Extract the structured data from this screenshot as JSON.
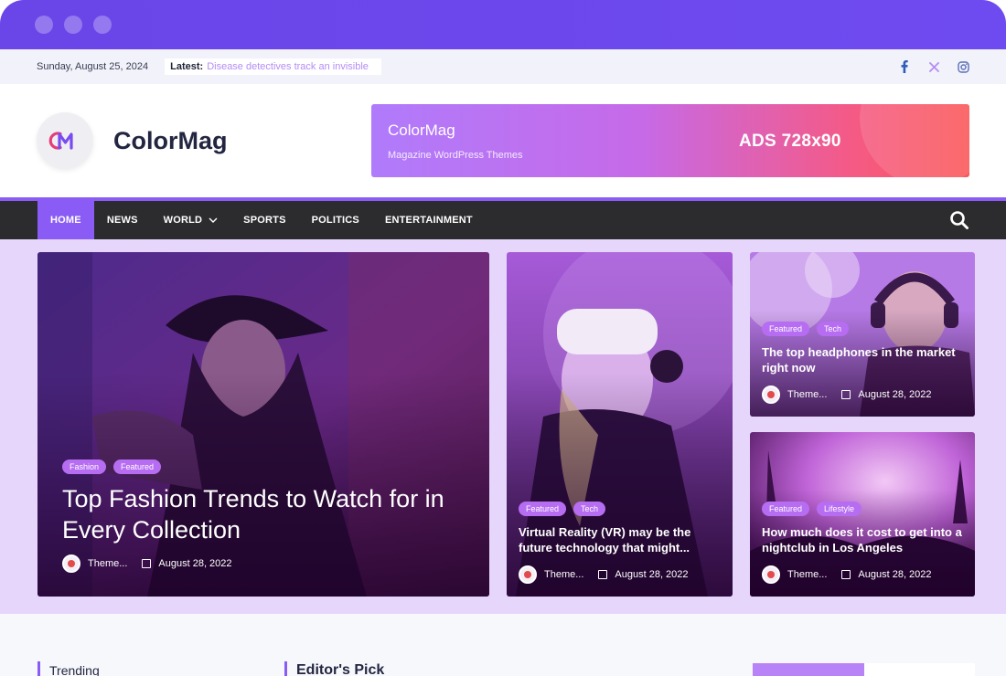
{
  "browser": {
    "dots": 3
  },
  "topbar": {
    "date": "Sunday, August 25, 2024",
    "latest_label": "Latest:",
    "latest_text": "Disease detectives track an invisible",
    "social_icons": [
      "facebook-icon",
      "x-icon",
      "instagram-icon"
    ]
  },
  "header": {
    "logo_mark": "CM",
    "site_title": "ColorMag",
    "ad": {
      "brand": "ColorMag",
      "subtitle": "Magazine WordPress Themes",
      "size": "ADS 728x90"
    }
  },
  "nav": {
    "items": [
      {
        "label": "HOME",
        "active": true
      },
      {
        "label": "NEWS"
      },
      {
        "label": "WORLD",
        "has_dropdown": true
      },
      {
        "label": "SPORTS"
      },
      {
        "label": "POLITICS"
      },
      {
        "label": "ENTERTAINMENT"
      }
    ],
    "search_icon": "search-icon"
  },
  "featured": [
    {
      "tags": [
        "Fashion",
        "Featured"
      ],
      "title": "Top Fashion Trends to Watch for in Every Collection",
      "author": "Theme...",
      "date": "August 28, 2022"
    },
    {
      "tags": [
        "Featured",
        "Tech"
      ],
      "title": "Virtual Reality (VR) may be the future technology that might...",
      "author": "Theme...",
      "date": "August 28, 2022"
    },
    {
      "tags": [
        "Featured",
        "Tech"
      ],
      "title": "The top headphones in the market right now",
      "author": "Theme...",
      "date": "August 28, 2022"
    },
    {
      "tags": [
        "Featured",
        "Lifestyle"
      ],
      "title": "How much does it cost to get into a nightclub in Los Angeles",
      "author": "Theme...",
      "date": "August 28, 2022"
    }
  ],
  "sections": {
    "trending": "Trending",
    "editors_pick": "Editor's Pick"
  },
  "colors": {
    "accent": "#8a5cf5",
    "chrome": "#6a45e8",
    "nav_bg": "#2c2c2f",
    "hero_bg": "#e6d6fb",
    "tag_bg": "#b66df2"
  }
}
